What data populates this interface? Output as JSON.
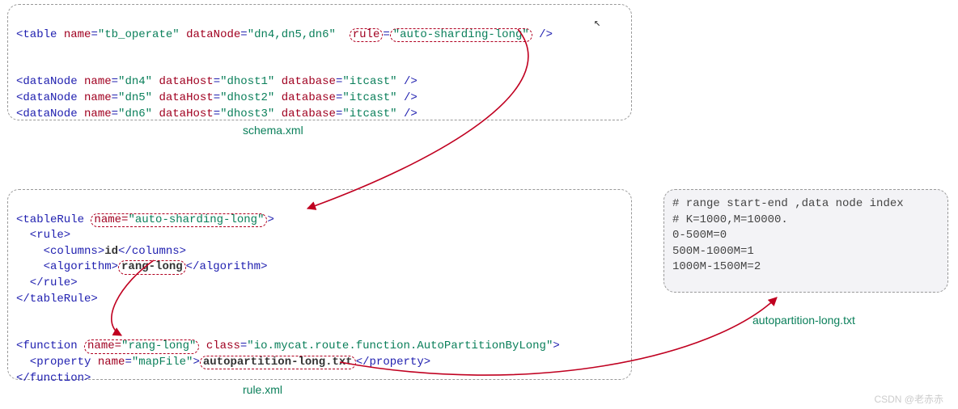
{
  "schema": {
    "caption": "schema.xml",
    "table_line": {
      "open": "<table",
      "name_attr": "name",
      "name_val": "\"tb_operate\"",
      "datanode_attr": "dataNode",
      "datanode_val": "\"dn4,dn5,dn6\"",
      "rule_attr_boxed": "rule",
      "rule_eq": "=",
      "rule_val_boxed": "\"auto-sharding-long\"",
      "close": " />"
    },
    "dn4": {
      "open": "<dataNode",
      "n_attr": "name",
      "n_val": "\"dn4\"",
      "h_attr": "dataHost",
      "h_val": "\"dhost1\"",
      "d_attr": "database",
      "d_val": "\"itcast\"",
      "close": " />"
    },
    "dn5": {
      "open": "<dataNode",
      "n_attr": "name",
      "n_val": "\"dn5\"",
      "h_attr": "dataHost",
      "h_val": "\"dhost2\"",
      "d_attr": "database",
      "d_val": "\"itcast\"",
      "close": " />"
    },
    "dn6": {
      "open": "<dataNode",
      "n_attr": "name",
      "n_val": "\"dn6\"",
      "h_attr": "dataHost",
      "h_val": "\"dhost3\"",
      "d_attr": "database",
      "d_val": "\"itcast\"",
      "close": " />"
    }
  },
  "rule": {
    "caption": "rule.xml",
    "tr_open": "<tableRule",
    "tr_name_attr_boxed": "name=",
    "tr_name_val_boxed": "\"auto-sharding-long\"",
    "tr_open_end": ">",
    "rule_open": "  <rule>",
    "cols_open": "    <columns>",
    "cols_val": "id",
    "cols_close": "</columns>",
    "alg_open": "    <algorithm>",
    "alg_val_box": "rang-long",
    "alg_close": "</algorithm>",
    "rule_close": "  </rule>",
    "tr_close": "</tableRule>",
    "fn_open": "<function",
    "fn_name_attr_box": "name=",
    "fn_name_val_box": "\"rang-long\"",
    "fn_class_attr": "class",
    "fn_class_val": "\"io.mycat.route.function.AutoPartitionByLong\"",
    "fn_open_end": ">",
    "prop_open": "  <property",
    "prop_name_attr": "name",
    "prop_name_val": "\"mapFile\"",
    "prop_val_box": "autopartition-long.txt",
    "prop_close": "</property>",
    "fn_close": "</function>"
  },
  "txt": {
    "caption": "autopartition-long.txt",
    "l1": "# range start-end ,data node index",
    "l2": "# K=1000,M=10000.",
    "l3": "0-500M=0",
    "l4": "500M-1000M=1",
    "l5": "1000M-1500M=2"
  },
  "watermark": "CSDN @老赤赤"
}
